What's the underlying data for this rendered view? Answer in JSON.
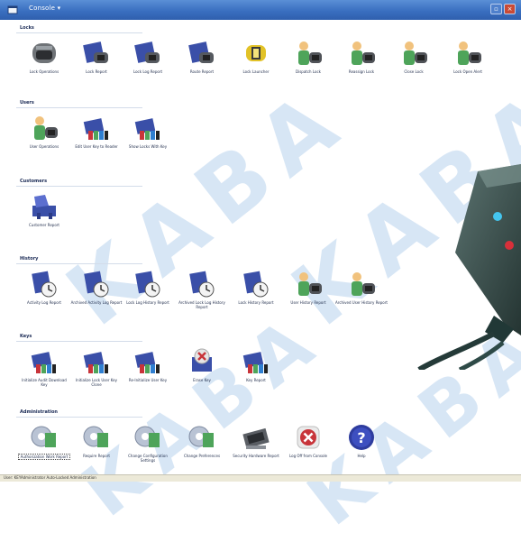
{
  "window": {
    "title": "Console ▾",
    "icon": "app-icon",
    "buttons": [
      "minimize-icon",
      "close-icon"
    ]
  },
  "sections": [
    {
      "label": "Locks",
      "tiles": [
        {
          "label": "Lock Operations",
          "icon": "lock-operations-icon"
        },
        {
          "label": "Lock Report",
          "icon": "lock-report-icon"
        },
        {
          "label": "Lock Log Report",
          "icon": "lock-log-report-icon"
        },
        {
          "label": "Route Report",
          "icon": "route-report-icon"
        },
        {
          "label": "Lock Launcher",
          "icon": "lock-launcher-icon"
        },
        {
          "label": "Dispatch Lock",
          "icon": "dispatch-lock-icon"
        },
        {
          "label": "Reassign Lock",
          "icon": "reassign-lock-icon"
        },
        {
          "label": "Close Lock",
          "icon": "close-lock-icon"
        },
        {
          "label": "Lock Open Alert",
          "icon": "lock-open-alert-icon"
        }
      ]
    },
    {
      "label": "Users",
      "tiles": [
        {
          "label": "User Operations",
          "icon": "user-operations-icon"
        },
        {
          "label": "Edit User Key to Reader",
          "icon": "edit-user-key-icon"
        },
        {
          "label": "Show Locks With Key",
          "icon": "show-locks-with-key-icon"
        }
      ]
    },
    {
      "label": "Customers",
      "tiles": [
        {
          "label": "Customer Report",
          "icon": "customer-report-icon"
        }
      ]
    },
    {
      "label": "History",
      "tiles": [
        {
          "label": "Activity Log Report",
          "icon": "activity-log-report-icon"
        },
        {
          "label": "Archived Activity Log Report",
          "icon": "archived-activity-log-icon"
        },
        {
          "label": "Lock Log History Report",
          "icon": "lock-log-history-icon"
        },
        {
          "label": "Archived Lock Log History Report",
          "icon": "archived-lock-log-history-icon"
        },
        {
          "label": "Lock History Report",
          "icon": "lock-history-report-icon"
        },
        {
          "label": "User History Report",
          "icon": "user-history-report-icon"
        },
        {
          "label": "Archived User History Report",
          "icon": "archived-user-history-icon"
        }
      ]
    },
    {
      "label": "Keys",
      "tiles": [
        {
          "label": "Initialize Audit Download Key",
          "icon": "initialize-audit-key-icon"
        },
        {
          "label": "Initialize Lock User Key Clone",
          "icon": "initialize-key-clone-icon"
        },
        {
          "label": "Re-Initialize User Key",
          "icon": "reinitialize-user-key-icon"
        },
        {
          "label": "Erase Key",
          "icon": "erase-key-icon"
        },
        {
          "label": "Key Report",
          "icon": "key-report-icon"
        }
      ]
    },
    {
      "label": "Administration",
      "tiles": [
        {
          "label": "Authorization Work Report",
          "icon": "authorization-report-icon"
        },
        {
          "label": "Require Report",
          "icon": "require-report-icon"
        },
        {
          "label": "Change Configuration Settings",
          "icon": "change-configuration-icon"
        },
        {
          "label": "Change Preferences",
          "icon": "change-preferences-icon"
        },
        {
          "label": "Security Hardware Report",
          "icon": "security-hardware-report-icon"
        },
        {
          "label": "Log Off from Console",
          "icon": "log-off-icon"
        },
        {
          "label": "Help",
          "icon": "help-icon"
        }
      ]
    }
  ],
  "status": {
    "text": "User: KEYAdministrator   Auto-Locked Administration"
  },
  "watermark": {
    "text": "KABA",
    "color": "#a0c4e6"
  },
  "colors": {
    "titlebar": "#3a6fc0",
    "tile_blue": "#3a4fa8",
    "tile_green": "#4ea45a",
    "warning_red": "#c8343a",
    "help_blue": "#2e3c9e"
  }
}
